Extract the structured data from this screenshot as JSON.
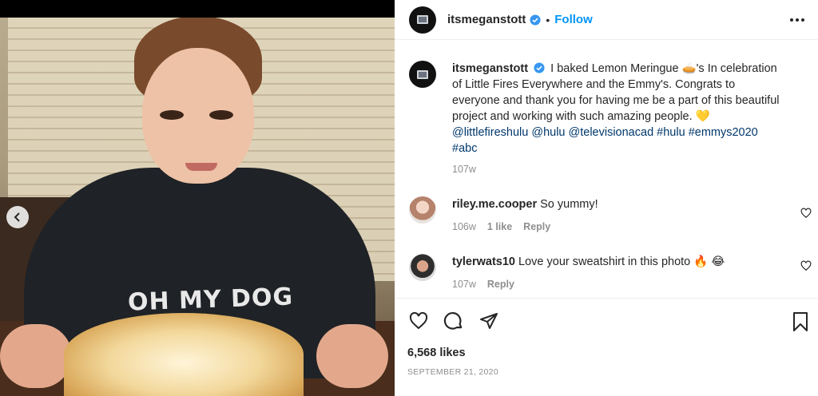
{
  "post": {
    "username": "itsmeganstott",
    "dot": "•",
    "follow_label": "Follow"
  },
  "caption": {
    "username": "itsmeganstott",
    "text_before_pie": "I baked Lemon Meringue",
    "pie_emoji": "🥧",
    "text_after_pie": "'s In celebration of Little Fires Everywhere and the Emmy's. Congrats to everyone and thank you for having me be a part of this beautiful project and working with such amazing people.",
    "heart_emoji": "💛",
    "tags": [
      "@littlefireshulu",
      "@hulu",
      "@televisionacad",
      "#hulu",
      "#emmys2020",
      "#abc"
    ],
    "age": "107w"
  },
  "comments": [
    {
      "username": "riley.me.cooper",
      "text": "So yummy!",
      "age": "106w",
      "likes": "1 like",
      "reply": "Reply"
    },
    {
      "username": "tylerwats10",
      "text": "Love your sweatshirt in this photo",
      "emojis": "🔥 😂",
      "age": "107w",
      "reply": "Reply"
    }
  ],
  "photo": {
    "shirt_text": "OH MY DOG"
  },
  "footer": {
    "likes": "6,568 likes",
    "date": "SEPTEMBER 21, 2020"
  },
  "colors": {
    "accent": "#0095f6",
    "tag": "#00376b",
    "muted": "#8e8e8e"
  },
  "icons": [
    "chevron-left-icon",
    "verified-icon",
    "more-icon",
    "heart-icon",
    "comment-icon",
    "share-icon",
    "bookmark-icon"
  ]
}
